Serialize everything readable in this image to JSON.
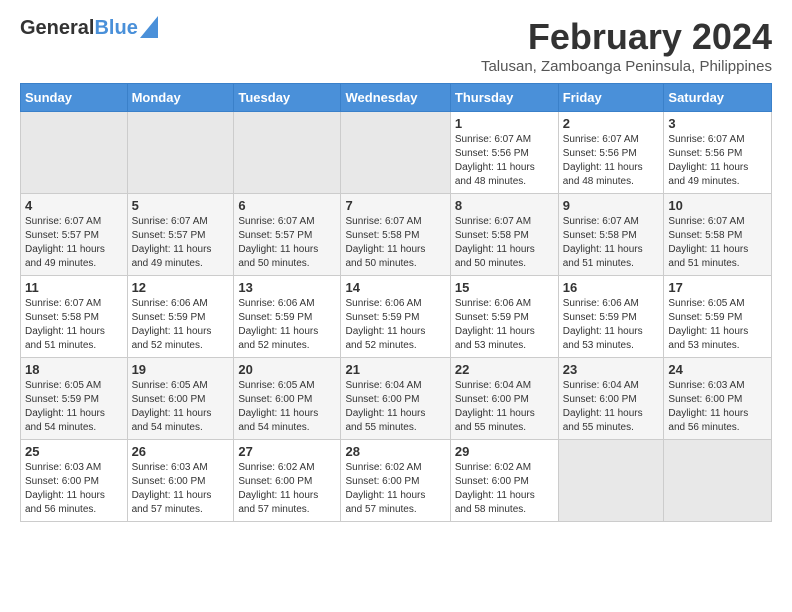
{
  "logo": {
    "general": "General",
    "blue": "Blue"
  },
  "title": {
    "month_year": "February 2024",
    "location": "Talusan, Zamboanga Peninsula, Philippines"
  },
  "headers": [
    "Sunday",
    "Monday",
    "Tuesday",
    "Wednesday",
    "Thursday",
    "Friday",
    "Saturday"
  ],
  "weeks": [
    [
      {
        "day": "",
        "info": ""
      },
      {
        "day": "",
        "info": ""
      },
      {
        "day": "",
        "info": ""
      },
      {
        "day": "",
        "info": ""
      },
      {
        "day": "1",
        "info": "Sunrise: 6:07 AM\nSunset: 5:56 PM\nDaylight: 11 hours\nand 48 minutes."
      },
      {
        "day": "2",
        "info": "Sunrise: 6:07 AM\nSunset: 5:56 PM\nDaylight: 11 hours\nand 48 minutes."
      },
      {
        "day": "3",
        "info": "Sunrise: 6:07 AM\nSunset: 5:56 PM\nDaylight: 11 hours\nand 49 minutes."
      }
    ],
    [
      {
        "day": "4",
        "info": "Sunrise: 6:07 AM\nSunset: 5:57 PM\nDaylight: 11 hours\nand 49 minutes."
      },
      {
        "day": "5",
        "info": "Sunrise: 6:07 AM\nSunset: 5:57 PM\nDaylight: 11 hours\nand 49 minutes."
      },
      {
        "day": "6",
        "info": "Sunrise: 6:07 AM\nSunset: 5:57 PM\nDaylight: 11 hours\nand 50 minutes."
      },
      {
        "day": "7",
        "info": "Sunrise: 6:07 AM\nSunset: 5:58 PM\nDaylight: 11 hours\nand 50 minutes."
      },
      {
        "day": "8",
        "info": "Sunrise: 6:07 AM\nSunset: 5:58 PM\nDaylight: 11 hours\nand 50 minutes."
      },
      {
        "day": "9",
        "info": "Sunrise: 6:07 AM\nSunset: 5:58 PM\nDaylight: 11 hours\nand 51 minutes."
      },
      {
        "day": "10",
        "info": "Sunrise: 6:07 AM\nSunset: 5:58 PM\nDaylight: 11 hours\nand 51 minutes."
      }
    ],
    [
      {
        "day": "11",
        "info": "Sunrise: 6:07 AM\nSunset: 5:58 PM\nDaylight: 11 hours\nand 51 minutes."
      },
      {
        "day": "12",
        "info": "Sunrise: 6:06 AM\nSunset: 5:59 PM\nDaylight: 11 hours\nand 52 minutes."
      },
      {
        "day": "13",
        "info": "Sunrise: 6:06 AM\nSunset: 5:59 PM\nDaylight: 11 hours\nand 52 minutes."
      },
      {
        "day": "14",
        "info": "Sunrise: 6:06 AM\nSunset: 5:59 PM\nDaylight: 11 hours\nand 52 minutes."
      },
      {
        "day": "15",
        "info": "Sunrise: 6:06 AM\nSunset: 5:59 PM\nDaylight: 11 hours\nand 53 minutes."
      },
      {
        "day": "16",
        "info": "Sunrise: 6:06 AM\nSunset: 5:59 PM\nDaylight: 11 hours\nand 53 minutes."
      },
      {
        "day": "17",
        "info": "Sunrise: 6:05 AM\nSunset: 5:59 PM\nDaylight: 11 hours\nand 53 minutes."
      }
    ],
    [
      {
        "day": "18",
        "info": "Sunrise: 6:05 AM\nSunset: 5:59 PM\nDaylight: 11 hours\nand 54 minutes."
      },
      {
        "day": "19",
        "info": "Sunrise: 6:05 AM\nSunset: 6:00 PM\nDaylight: 11 hours\nand 54 minutes."
      },
      {
        "day": "20",
        "info": "Sunrise: 6:05 AM\nSunset: 6:00 PM\nDaylight: 11 hours\nand 54 minutes."
      },
      {
        "day": "21",
        "info": "Sunrise: 6:04 AM\nSunset: 6:00 PM\nDaylight: 11 hours\nand 55 minutes."
      },
      {
        "day": "22",
        "info": "Sunrise: 6:04 AM\nSunset: 6:00 PM\nDaylight: 11 hours\nand 55 minutes."
      },
      {
        "day": "23",
        "info": "Sunrise: 6:04 AM\nSunset: 6:00 PM\nDaylight: 11 hours\nand 55 minutes."
      },
      {
        "day": "24",
        "info": "Sunrise: 6:03 AM\nSunset: 6:00 PM\nDaylight: 11 hours\nand 56 minutes."
      }
    ],
    [
      {
        "day": "25",
        "info": "Sunrise: 6:03 AM\nSunset: 6:00 PM\nDaylight: 11 hours\nand 56 minutes."
      },
      {
        "day": "26",
        "info": "Sunrise: 6:03 AM\nSunset: 6:00 PM\nDaylight: 11 hours\nand 57 minutes."
      },
      {
        "day": "27",
        "info": "Sunrise: 6:02 AM\nSunset: 6:00 PM\nDaylight: 11 hours\nand 57 minutes."
      },
      {
        "day": "28",
        "info": "Sunrise: 6:02 AM\nSunset: 6:00 PM\nDaylight: 11 hours\nand 57 minutes."
      },
      {
        "day": "29",
        "info": "Sunrise: 6:02 AM\nSunset: 6:00 PM\nDaylight: 11 hours\nand 58 minutes."
      },
      {
        "day": "",
        "info": ""
      },
      {
        "day": "",
        "info": ""
      }
    ]
  ]
}
